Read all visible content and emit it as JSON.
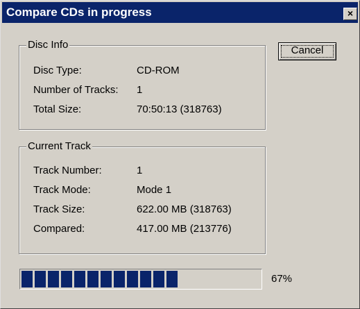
{
  "window": {
    "title": "Compare CDs in progress",
    "close_glyph": "×"
  },
  "disc_info": {
    "legend": "Disc Info",
    "rows": [
      {
        "label": "Disc Type:",
        "value": "CD-ROM"
      },
      {
        "label": "Number of Tracks:",
        "value": "1"
      },
      {
        "label": "Total Size:",
        "value": "70:50:13 (318763)"
      }
    ]
  },
  "current_track": {
    "legend": "Current Track",
    "rows": [
      {
        "label": "Track Number:",
        "value": "1"
      },
      {
        "label": "Track Mode:",
        "value": "Mode 1"
      },
      {
        "label": "Track Size:",
        "value": "622.00 MB (318763)"
      },
      {
        "label": "Compared:",
        "value": "417.00 MB (213776)"
      }
    ]
  },
  "buttons": {
    "cancel_label": "Cancel"
  },
  "progress": {
    "percent_text": "67%",
    "fraction": 0.67
  },
  "colors": {
    "title_bar": "#0a246a",
    "progress_fill": "#0a246a",
    "face": "#d4d0c8"
  }
}
